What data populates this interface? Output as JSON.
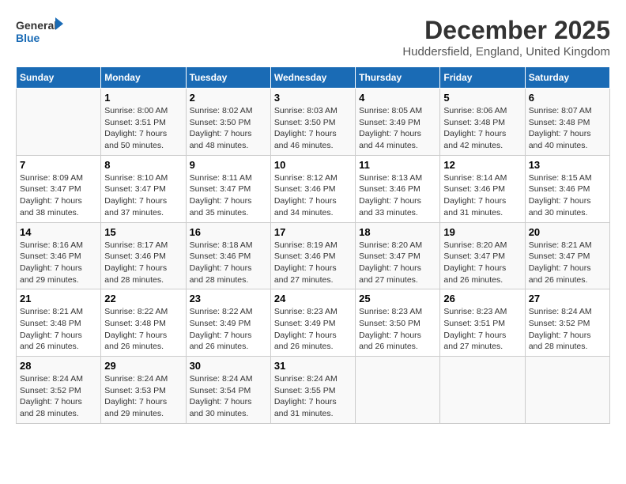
{
  "header": {
    "logo_general": "General",
    "logo_blue": "Blue",
    "month_title": "December 2025",
    "location": "Huddersfield, England, United Kingdom"
  },
  "days_of_week": [
    "Sunday",
    "Monday",
    "Tuesday",
    "Wednesday",
    "Thursday",
    "Friday",
    "Saturday"
  ],
  "weeks": [
    [
      {
        "day": "",
        "empty": true
      },
      {
        "day": "1",
        "sunrise": "Sunrise: 8:00 AM",
        "sunset": "Sunset: 3:51 PM",
        "daylight": "Daylight: 7 hours and 50 minutes."
      },
      {
        "day": "2",
        "sunrise": "Sunrise: 8:02 AM",
        "sunset": "Sunset: 3:50 PM",
        "daylight": "Daylight: 7 hours and 48 minutes."
      },
      {
        "day": "3",
        "sunrise": "Sunrise: 8:03 AM",
        "sunset": "Sunset: 3:50 PM",
        "daylight": "Daylight: 7 hours and 46 minutes."
      },
      {
        "day": "4",
        "sunrise": "Sunrise: 8:05 AM",
        "sunset": "Sunset: 3:49 PM",
        "daylight": "Daylight: 7 hours and 44 minutes."
      },
      {
        "day": "5",
        "sunrise": "Sunrise: 8:06 AM",
        "sunset": "Sunset: 3:48 PM",
        "daylight": "Daylight: 7 hours and 42 minutes."
      },
      {
        "day": "6",
        "sunrise": "Sunrise: 8:07 AM",
        "sunset": "Sunset: 3:48 PM",
        "daylight": "Daylight: 7 hours and 40 minutes."
      }
    ],
    [
      {
        "day": "7",
        "sunrise": "Sunrise: 8:09 AM",
        "sunset": "Sunset: 3:47 PM",
        "daylight": "Daylight: 7 hours and 38 minutes."
      },
      {
        "day": "8",
        "sunrise": "Sunrise: 8:10 AM",
        "sunset": "Sunset: 3:47 PM",
        "daylight": "Daylight: 7 hours and 37 minutes."
      },
      {
        "day": "9",
        "sunrise": "Sunrise: 8:11 AM",
        "sunset": "Sunset: 3:47 PM",
        "daylight": "Daylight: 7 hours and 35 minutes."
      },
      {
        "day": "10",
        "sunrise": "Sunrise: 8:12 AM",
        "sunset": "Sunset: 3:46 PM",
        "daylight": "Daylight: 7 hours and 34 minutes."
      },
      {
        "day": "11",
        "sunrise": "Sunrise: 8:13 AM",
        "sunset": "Sunset: 3:46 PM",
        "daylight": "Daylight: 7 hours and 33 minutes."
      },
      {
        "day": "12",
        "sunrise": "Sunrise: 8:14 AM",
        "sunset": "Sunset: 3:46 PM",
        "daylight": "Daylight: 7 hours and 31 minutes."
      },
      {
        "day": "13",
        "sunrise": "Sunrise: 8:15 AM",
        "sunset": "Sunset: 3:46 PM",
        "daylight": "Daylight: 7 hours and 30 minutes."
      }
    ],
    [
      {
        "day": "14",
        "sunrise": "Sunrise: 8:16 AM",
        "sunset": "Sunset: 3:46 PM",
        "daylight": "Daylight: 7 hours and 29 minutes."
      },
      {
        "day": "15",
        "sunrise": "Sunrise: 8:17 AM",
        "sunset": "Sunset: 3:46 PM",
        "daylight": "Daylight: 7 hours and 28 minutes."
      },
      {
        "day": "16",
        "sunrise": "Sunrise: 8:18 AM",
        "sunset": "Sunset: 3:46 PM",
        "daylight": "Daylight: 7 hours and 28 minutes."
      },
      {
        "day": "17",
        "sunrise": "Sunrise: 8:19 AM",
        "sunset": "Sunset: 3:46 PM",
        "daylight": "Daylight: 7 hours and 27 minutes."
      },
      {
        "day": "18",
        "sunrise": "Sunrise: 8:20 AM",
        "sunset": "Sunset: 3:47 PM",
        "daylight": "Daylight: 7 hours and 27 minutes."
      },
      {
        "day": "19",
        "sunrise": "Sunrise: 8:20 AM",
        "sunset": "Sunset: 3:47 PM",
        "daylight": "Daylight: 7 hours and 26 minutes."
      },
      {
        "day": "20",
        "sunrise": "Sunrise: 8:21 AM",
        "sunset": "Sunset: 3:47 PM",
        "daylight": "Daylight: 7 hours and 26 minutes."
      }
    ],
    [
      {
        "day": "21",
        "sunrise": "Sunrise: 8:21 AM",
        "sunset": "Sunset: 3:48 PM",
        "daylight": "Daylight: 7 hours and 26 minutes."
      },
      {
        "day": "22",
        "sunrise": "Sunrise: 8:22 AM",
        "sunset": "Sunset: 3:48 PM",
        "daylight": "Daylight: 7 hours and 26 minutes."
      },
      {
        "day": "23",
        "sunrise": "Sunrise: 8:22 AM",
        "sunset": "Sunset: 3:49 PM",
        "daylight": "Daylight: 7 hours and 26 minutes."
      },
      {
        "day": "24",
        "sunrise": "Sunrise: 8:23 AM",
        "sunset": "Sunset: 3:49 PM",
        "daylight": "Daylight: 7 hours and 26 minutes."
      },
      {
        "day": "25",
        "sunrise": "Sunrise: 8:23 AM",
        "sunset": "Sunset: 3:50 PM",
        "daylight": "Daylight: 7 hours and 26 minutes."
      },
      {
        "day": "26",
        "sunrise": "Sunrise: 8:23 AM",
        "sunset": "Sunset: 3:51 PM",
        "daylight": "Daylight: 7 hours and 27 minutes."
      },
      {
        "day": "27",
        "sunrise": "Sunrise: 8:24 AM",
        "sunset": "Sunset: 3:52 PM",
        "daylight": "Daylight: 7 hours and 28 minutes."
      }
    ],
    [
      {
        "day": "28",
        "sunrise": "Sunrise: 8:24 AM",
        "sunset": "Sunset: 3:52 PM",
        "daylight": "Daylight: 7 hours and 28 minutes."
      },
      {
        "day": "29",
        "sunrise": "Sunrise: 8:24 AM",
        "sunset": "Sunset: 3:53 PM",
        "daylight": "Daylight: 7 hours and 29 minutes."
      },
      {
        "day": "30",
        "sunrise": "Sunrise: 8:24 AM",
        "sunset": "Sunset: 3:54 PM",
        "daylight": "Daylight: 7 hours and 30 minutes."
      },
      {
        "day": "31",
        "sunrise": "Sunrise: 8:24 AM",
        "sunset": "Sunset: 3:55 PM",
        "daylight": "Daylight: 7 hours and 31 minutes."
      },
      {
        "day": "",
        "empty": true
      },
      {
        "day": "",
        "empty": true
      },
      {
        "day": "",
        "empty": true
      }
    ]
  ]
}
